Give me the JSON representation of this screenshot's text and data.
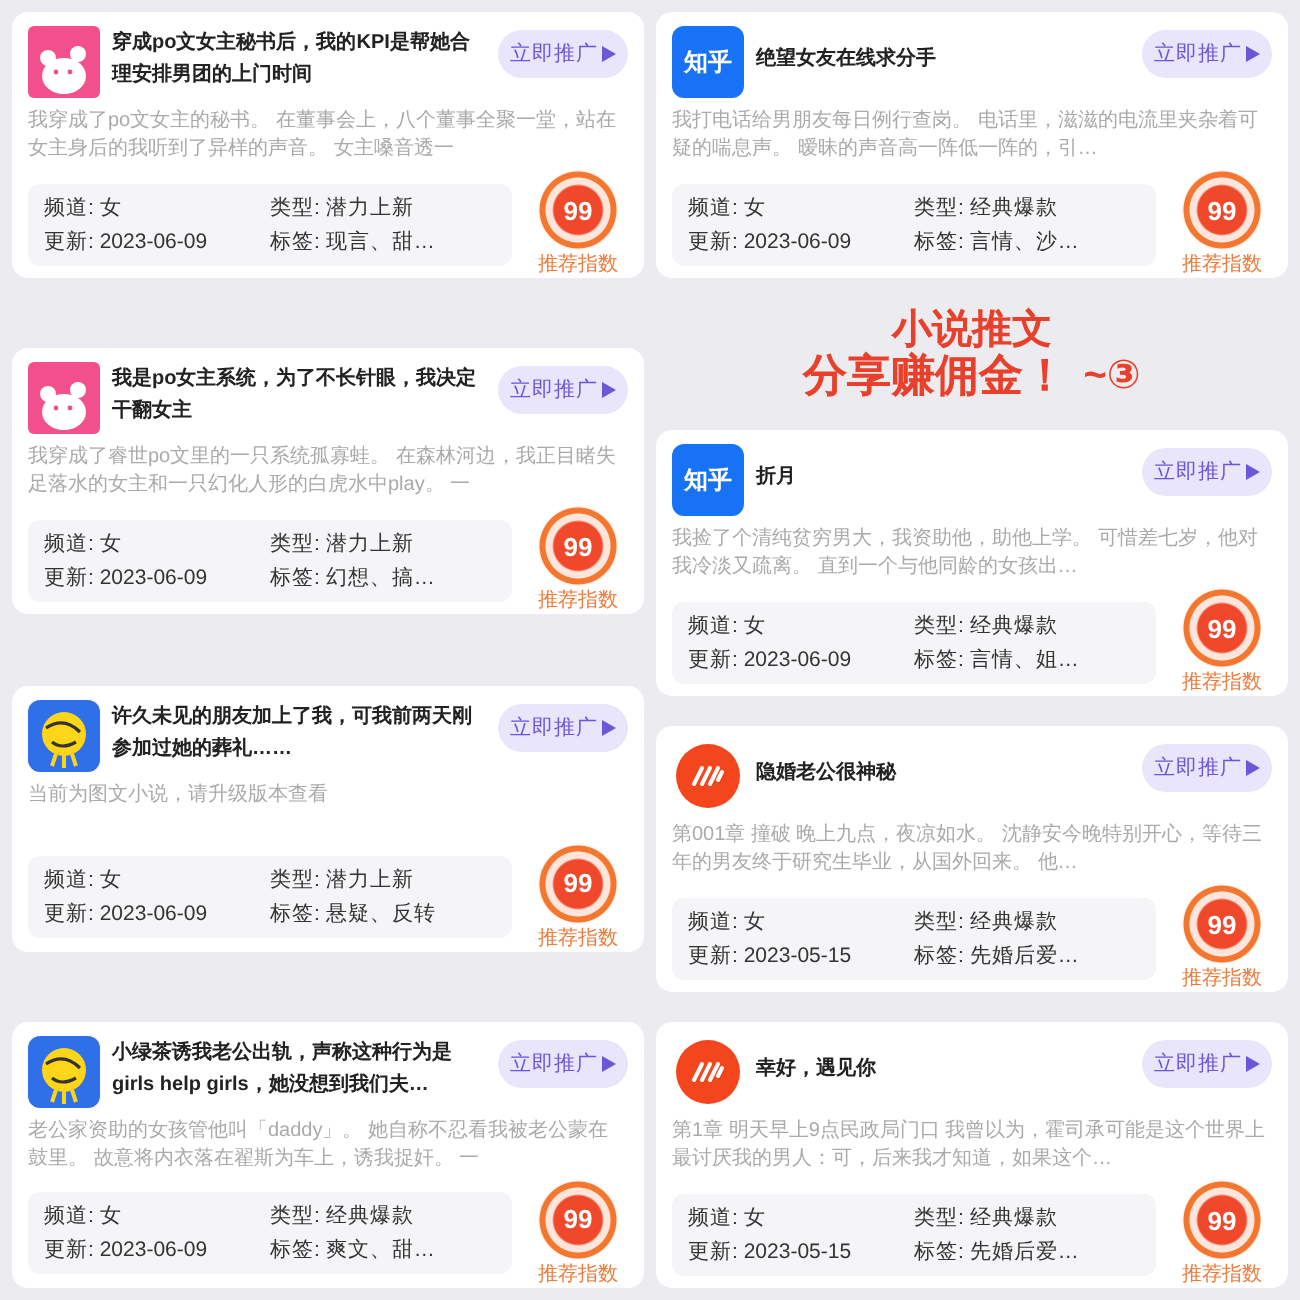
{
  "columns": [
    {
      "cards": [
        {
          "kind": "bear",
          "title": "穿成po文女主秘书后，我的KPI是帮她合理安排男团的上门时间",
          "button": "立即推广",
          "description": "我穿成了po文女主的秘书。 在董事会上，八个董事全聚一堂，站在女主身后的我听到了异样的声音。 女主嗓音透一",
          "info": [
            "频道: 女",
            "类型: 潜力上新",
            "更新: 2023-06-09",
            "标签: 现言、甜…"
          ],
          "score": "99",
          "score_label": "推荐指数"
        },
        {
          "kind": "bear",
          "title": "我是po女主系统，为了不长针眼，我决定干翻女主",
          "button": "立即推广",
          "description": "我穿成了睿世po文里的一只系统孤寡蛙。 在森林河边，我正目睹失足落水的女主和一只幻化人形的白虎水中play。 一",
          "info": [
            "频道: 女",
            "类型: 潜力上新",
            "更新: 2023-06-09",
            "标签: 幻想、搞…"
          ],
          "score": "99",
          "score_label": "推荐指数"
        },
        {
          "kind": "duck",
          "title": "许久未见的朋友加上了我，可我前两天刚参加过她的葬礼……",
          "button": "立即推广",
          "description": "当前为图文小说，请升级版本查看",
          "info": [
            "频道: 女",
            "类型: 潜力上新",
            "更新: 2023-06-09",
            "标签: 悬疑、反转"
          ],
          "score": "99",
          "score_label": "推荐指数"
        },
        {
          "kind": "duck",
          "title": "小绿茶诱我老公出轨，声称这种行为是girls help girls，她没想到我们夫…",
          "button": "立即推广",
          "description": "老公家资助的女孩管他叫「daddy」。 她自称不忍看我被老公蒙在鼓里。 故意将内衣落在翟斯为车上，诱我捉奸。 一",
          "info": [
            "频道: 女",
            "类型: 经典爆款",
            "更新: 2023-06-09",
            "标签: 爽文、甜…"
          ],
          "score": "99",
          "score_label": "推荐指数"
        }
      ]
    },
    {
      "cards": [
        {
          "kind": "zhihu",
          "icon_text": "知乎",
          "title": "绝望女友在线求分手",
          "button": "立即推广",
          "description": "我打电话给男朋友每日例行查岗。 电话里，滋滋的电流里夹杂着可疑的喘息声。 暧昧的声音高一阵低一阵的，引…",
          "info": [
            "频道: 女",
            "类型: 经典爆款",
            "更新: 2023-06-09",
            "标签: 言情、沙…"
          ],
          "score": "99",
          "score_label": "推荐指数"
        },
        {
          "kind": "zhihu",
          "icon_text": "知乎",
          "title": "折月",
          "button": "立即推广",
          "description": "我捡了个清纯贫穷男大，我资助他，助他上学。 可惜差七岁，他对我冷淡又疏离。 直到一个与他同龄的女孩出…",
          "info": [
            "频道: 女",
            "类型: 经典爆款",
            "更新: 2023-06-09",
            "标签: 言情、姐…"
          ],
          "score": "99",
          "score_label": "推荐指数"
        },
        {
          "kind": "wave",
          "title": "隐婚老公很神秘",
          "button": "立即推广",
          "description": "第001章 撞破 晚上九点，夜凉如水。 沈静安今晚特别开心，等待三年的男友终于研究生毕业，从国外回来。 他…",
          "info": [
            "频道: 女",
            "类型: 经典爆款",
            "更新: 2023-05-15",
            "标签: 先婚后爱…"
          ],
          "score": "99",
          "score_label": "推荐指数"
        },
        {
          "kind": "wave",
          "title": "幸好，遇见你",
          "button": "立即推广",
          "description": "第1章 明天早上9点民政局门口 我曾以为，霍司承可能是这个世界上最讨厌我的男人：可，后来我才知道，如果这个…",
          "info": [
            "频道: 女",
            "类型: 经典爆款",
            "更新: 2023-05-15",
            "标签: 先婚后爱…"
          ],
          "score": "99",
          "score_label": "推荐指数"
        }
      ]
    }
  ],
  "overlay": {
    "lines": [
      "小说推文",
      "分享赚佣金！",
      "~③"
    ]
  }
}
